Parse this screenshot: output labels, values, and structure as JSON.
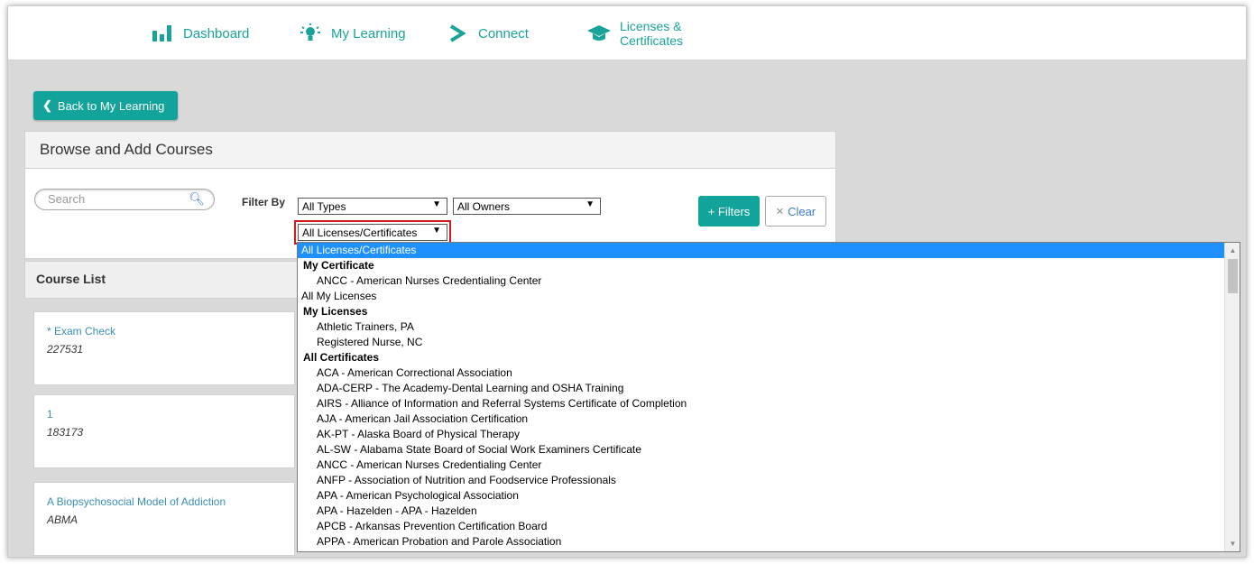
{
  "nav": {
    "dashboard": "Dashboard",
    "my_learning": "My Learning",
    "connect": "Connect",
    "licenses_line1": "Licenses &",
    "licenses_line2": "Certificates"
  },
  "back_button": "Back to My Learning",
  "panel_title": "Browse and Add Courses",
  "search": {
    "placeholder": "Search"
  },
  "filter_by": "Filter By",
  "selects": {
    "types": "All Types",
    "owners": "All Owners",
    "licenses": "All Licenses/Certificates"
  },
  "buttons": {
    "filters": "+ Filters",
    "clear": "Clear"
  },
  "course_list_title": "Course List",
  "courses": [
    {
      "title": "* Exam Check",
      "code": "227531"
    },
    {
      "title": "1",
      "code": "183173"
    },
    {
      "title": "A Biopsychosocial Model of Addiction",
      "code": "ABMA"
    }
  ],
  "dropdown_options": [
    {
      "label": "All Licenses/Certificates",
      "kind": "selected"
    },
    {
      "label": "My Certificate",
      "kind": "group"
    },
    {
      "label": "ANCC - American Nurses Credentialing Center",
      "kind": "child"
    },
    {
      "label": "All My Licenses",
      "kind": "plain"
    },
    {
      "label": "My Licenses",
      "kind": "group"
    },
    {
      "label": "Athletic Trainers, PA",
      "kind": "child"
    },
    {
      "label": "Registered Nurse, NC",
      "kind": "child"
    },
    {
      "label": "All Certificates",
      "kind": "group"
    },
    {
      "label": "ACA - American Correctional Association",
      "kind": "child"
    },
    {
      "label": "ADA-CERP - The Academy-Dental Learning and OSHA Training",
      "kind": "child"
    },
    {
      "label": "AIRS - Alliance of Information and Referral Systems Certificate of Completion",
      "kind": "child"
    },
    {
      "label": "AJA - American Jail Association Certification",
      "kind": "child"
    },
    {
      "label": "AK-PT - Alaska Board of Physical Therapy",
      "kind": "child"
    },
    {
      "label": "AL-SW - Alabama State Board of Social Work Examiners Certificate",
      "kind": "child"
    },
    {
      "label": "ANCC - American Nurses Credentialing Center",
      "kind": "child"
    },
    {
      "label": "ANFP - Association of Nutrition and Foodservice Professionals",
      "kind": "child"
    },
    {
      "label": "APA - American Psychological Association",
      "kind": "child"
    },
    {
      "label": "APA - Hazelden - APA - Hazelden",
      "kind": "child"
    },
    {
      "label": "APCB - Arkansas Prevention Certification Board",
      "kind": "child"
    },
    {
      "label": "APPA - American Probation and Parole Association",
      "kind": "child"
    }
  ],
  "colors": {
    "accent": "#12a39a",
    "highlight": "#d7191c",
    "selection": "#1e90ff"
  }
}
